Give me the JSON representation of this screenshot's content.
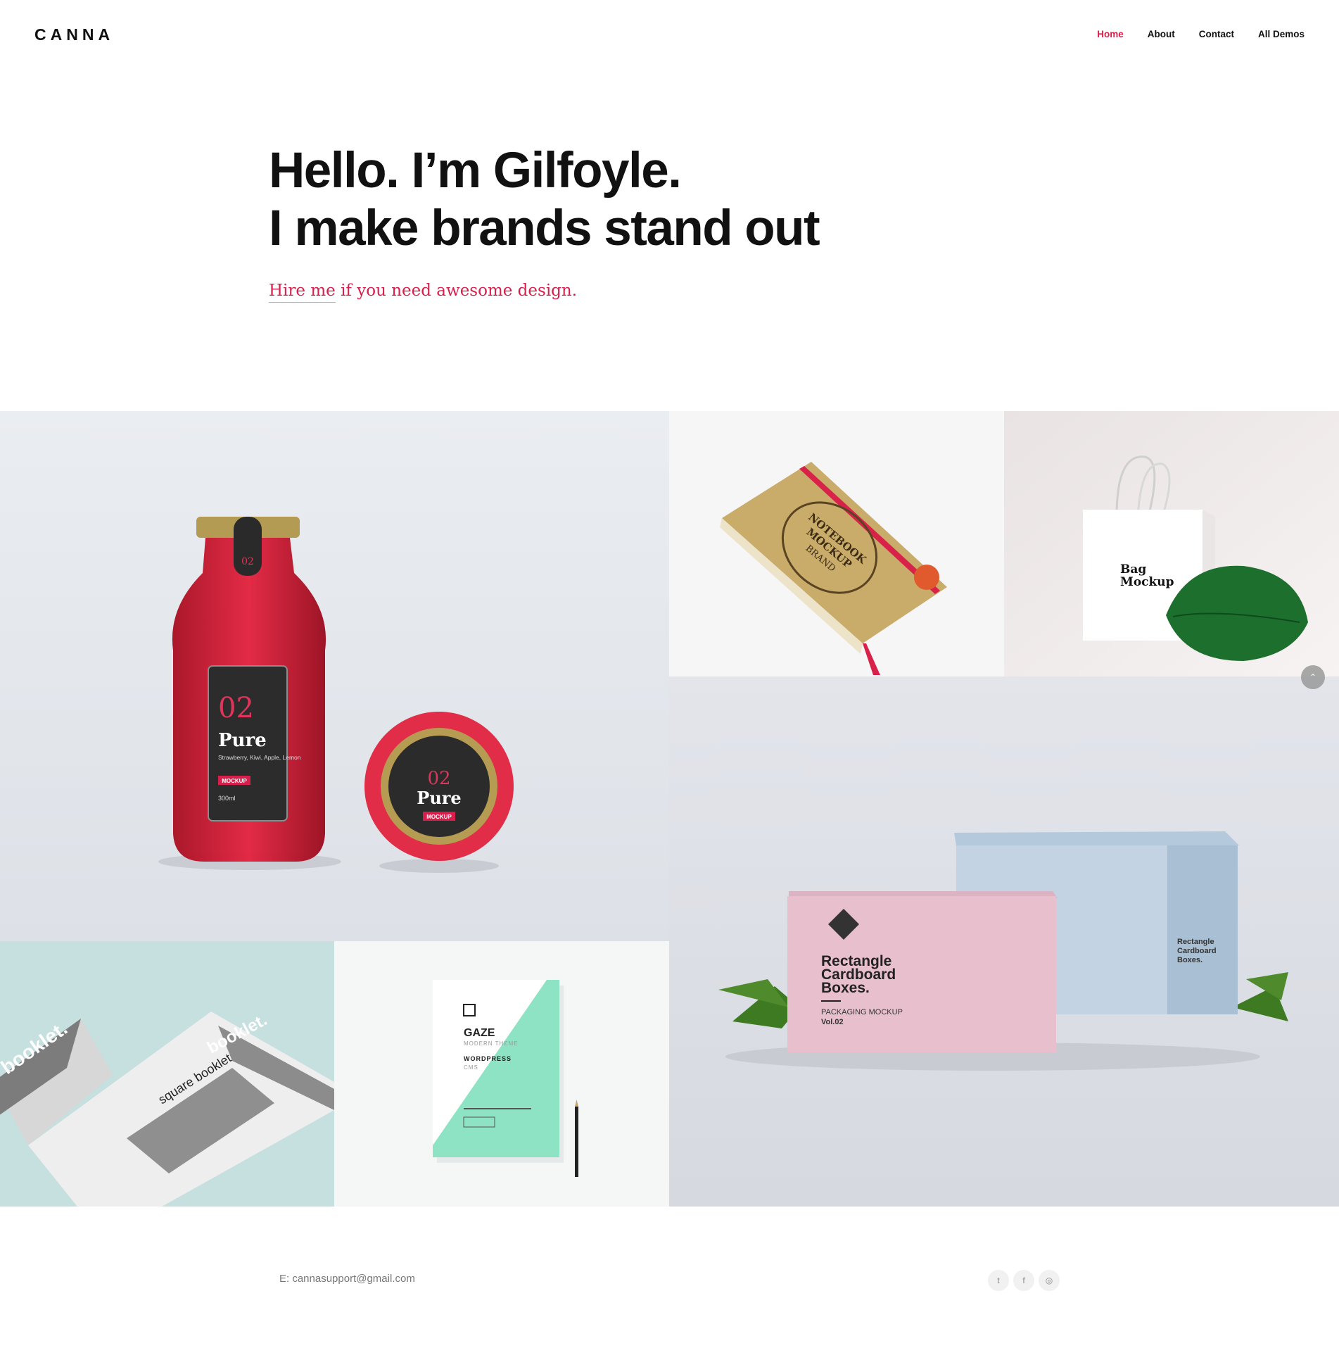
{
  "brand": {
    "logo": "CANNA"
  },
  "nav": {
    "items": [
      {
        "label": "Home",
        "active": true
      },
      {
        "label": "About",
        "active": false
      },
      {
        "label": "Contact",
        "active": false
      },
      {
        "label": "All Demos",
        "active": false
      }
    ]
  },
  "hero": {
    "line1": "Hello. I’m Gilfoyle.",
    "line2": "I make brands stand out",
    "cta_link": "Hire me",
    "cta_rest": " if you need awesome design."
  },
  "portfolio": {
    "juice": {
      "number": "02",
      "name": "Pure",
      "flavors": "Strawberry, Kiwi, Apple, Lemon",
      "badge": "MOCKUP",
      "volume": "300ml"
    },
    "notebook": {
      "line1": "NOTEBOOK",
      "line2": "MOCKUP",
      "line3": "BRAND"
    },
    "bag": {
      "line1": "Bag",
      "line2": "Mockup"
    },
    "boxes": {
      "line1": "Rectangle",
      "line2": "Cardboard",
      "line3": "Boxes.",
      "sub": "PACKAGING MOCKUP",
      "vol": "Vol.02"
    },
    "booklet": {
      "title": "square booklet",
      "cover": "booklet."
    },
    "gaze": {
      "title": "GAZE",
      "sub": "MODERN THEME",
      "platform": "WORDPRESS",
      "cms": "CMS"
    }
  },
  "footer": {
    "email": "E: cannasupport@gmail.com",
    "social": [
      {
        "icon": "twitter-icon",
        "glyph": "t"
      },
      {
        "icon": "facebook-icon",
        "glyph": "f"
      },
      {
        "icon": "instagram-icon",
        "glyph": "◎"
      }
    ]
  },
  "colors": {
    "accent": "#d81e4a",
    "text": "#111111"
  }
}
